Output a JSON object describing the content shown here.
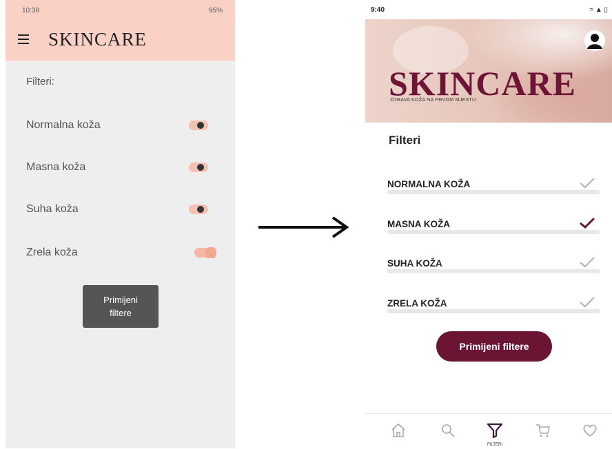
{
  "left_screen": {
    "status": {
      "time": "10:38",
      "battery": "95%"
    },
    "app_title": "SKINCARE",
    "filters_label": "Filteri:",
    "options": [
      {
        "label": "Normalna koža",
        "on": false
      },
      {
        "label": "Masna koža",
        "on": false
      },
      {
        "label": "Suha koža",
        "on": false
      },
      {
        "label": "Zrela koža",
        "on": true
      }
    ],
    "apply_label_line1": "Primijeni",
    "apply_label_line2": "filtere"
  },
  "right_screen": {
    "status": {
      "time": "9:40"
    },
    "brand": "SKINCARE",
    "tagline": "ZDRAVA KOŽA NA PRVOM MJESTU.",
    "filters_title": "Filteri",
    "options": [
      {
        "label": "NORMALNA KOŽA",
        "checked": false
      },
      {
        "label": "MASNA KOŽA",
        "checked": true
      },
      {
        "label": "SUHA KOŽA",
        "checked": false
      },
      {
        "label": "ZRELA KOŽA",
        "checked": false
      }
    ],
    "apply_label": "Primijeni filtere",
    "nav": {
      "filter_label": "FILTERI"
    }
  },
  "colors": {
    "left_header": "#fbd0c5",
    "brand": "#6e1437",
    "button": "#6b1434",
    "check_active": "#6b1434",
    "check_inactive": "#b5b5b5"
  },
  "icons": [
    "hamburger-icon",
    "profile-icon",
    "checkmark-icon",
    "arrow-right-icon",
    "home-icon",
    "search-icon",
    "filter-icon",
    "cart-icon",
    "heart-icon"
  ]
}
